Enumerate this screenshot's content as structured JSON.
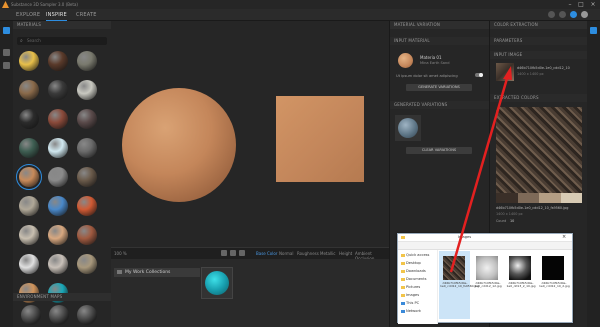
{
  "window": {
    "title": "Substance 3D Sampler 3.0 (Beta)"
  },
  "tabs": [
    {
      "label": "EXPLORE"
    },
    {
      "label": "INSPIRE"
    },
    {
      "label": "CREATE"
    }
  ],
  "panels": {
    "materials": {
      "title": "MATERIALS",
      "search_placeholder": "Search",
      "footer_title": "ENVIRONMENT MAPS"
    },
    "material_variation": {
      "title": "MATERIAL VARIATION",
      "input_section": "INPUT MATERIAL",
      "material_name": "Materia 01",
      "material_sub": "Mina Earth Sand",
      "toggle_label": "Ut ipsum dolor sit amet adipiscing",
      "generate_button": "GENERATE VARIATIONS",
      "generated_section": "GENERATED VARIATIONS",
      "remove_button": "CLEAR VARIATIONS"
    },
    "color_extraction": {
      "title": "COLOR EXTRACTION",
      "params_section": "PARAMETERS",
      "input_image_section": "INPUT IMAGE",
      "input_filename": "d46b710fb5d0e-1e0_cdd12_10",
      "input_size": "1400 x 1400 px",
      "extracted_section": "EXTRACTED COLORS",
      "file_caption": "d46b710fb5d0e-1e0_cdd12_10_fs9560.jpg",
      "file_meta": "1400 x 1400 px",
      "count_label": "Count",
      "count_value": "10"
    }
  },
  "viewport": {
    "zoom": "100 %",
    "view_tabs": [
      {
        "label": "Base Color"
      },
      {
        "label": "Normal"
      },
      {
        "label": "Roughness"
      },
      {
        "label": "Metallic"
      },
      {
        "label": "Height"
      },
      {
        "label": "Ambient Occlusion"
      }
    ],
    "collections_label": "My Work Collections"
  },
  "explorer": {
    "title": "Images",
    "nav": [
      "Quick access",
      "Desktop",
      "Downloads",
      "Documents",
      "Pictures",
      "Images",
      "This PC",
      "Network"
    ],
    "files": [
      {
        "name": "d46b710fb5d0e-1e0_cdd12_10_fs9560.jpg"
      },
      {
        "name": "d46b710fb5d0e-1e0_cdd12_12.jpg"
      },
      {
        "name": "d46b710fb5d0e-1e0_dd13_2_10.jpg"
      },
      {
        "name": "d46b710fb5d0e-1e0_cdd12_10_2.jpg"
      }
    ]
  },
  "colors": {
    "accent": "#2d8de0",
    "arrow": "#e32020",
    "panel_bg": "#262626",
    "sand": "#c78a5a",
    "extracted_swatches": [
      "#3a2f28",
      "#7e6a58",
      "#b49e84",
      "#d8cbb4"
    ]
  },
  "icons": {
    "title_logo": "sampler-logo-icon",
    "search": "search-icon",
    "close": "close-icon",
    "minimize": "minimize-icon",
    "maximize": "maximize-icon"
  }
}
